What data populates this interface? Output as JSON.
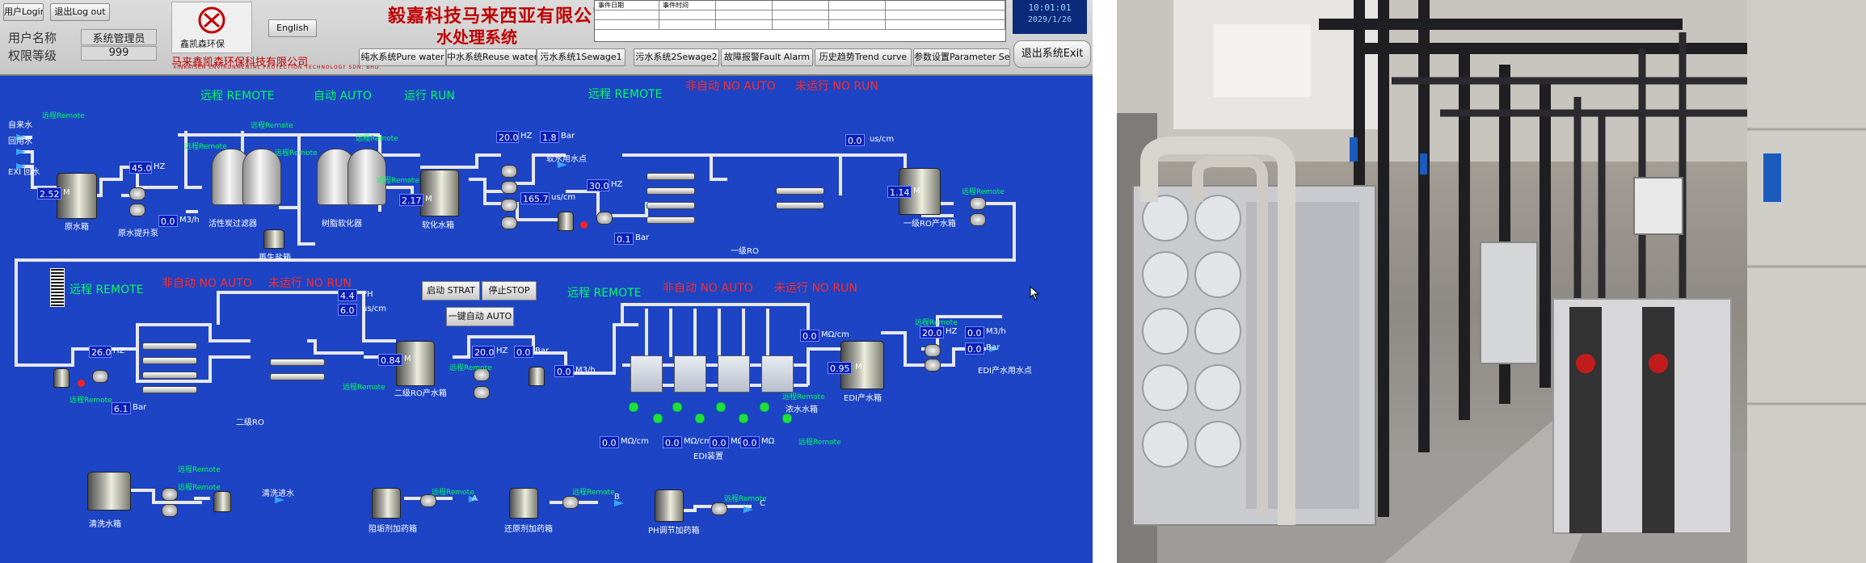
{
  "header": {
    "login_button": "用户Login",
    "logout_button": "退出Log out",
    "user_label": "用户名称",
    "user_value": "系统管理员",
    "level_label": "权限等级",
    "level_value": "999",
    "logo_text": "鑫凯森环保",
    "english_button": "English",
    "company_name": "毅嘉科技马来西亚有限公司",
    "system_title": "水处理系统",
    "sub_company": "马来鑫凯森环保科技有限公司",
    "sub_company_en": "XINKAISEN ENVIRONMENTAL PROTECTION TECHNOLOGY SDN. BHD.",
    "alarm_col1": "事件日期",
    "alarm_col2": "事件时间",
    "clock_time": "10:01:01",
    "clock_date": "2029/1/26"
  },
  "nav": [
    "纯水系统Pure water",
    "中水系统Reuse water",
    "污水系统1Sewage1",
    "污水系统2Sewage2",
    "故障报警Fault Alarm",
    "历史趋势Trend curve",
    "参数设置Parameter Set",
    "退出系统Exit"
  ],
  "status": {
    "remote": "远程 REMOTE",
    "auto": "自动 AUTO",
    "run": "运行 RUN",
    "not_auto": "非自动 NO AUTO",
    "not_run": "未运行 NO RUN",
    "remote_small": "远程Remote"
  },
  "labels": {
    "tap_water": "自来水",
    "reuse_water": "回用水",
    "exi_return": "EXI 回水",
    "raw_tank": "原水箱",
    "raw_pump": "原水提升泵",
    "carbon_filter": "活性炭过滤器",
    "resin_softener": "树脂软化器",
    "salt_box": "再生盐箱",
    "soft_tank": "软化水箱",
    "soft_point": "软水用水点",
    "ro1": "一级RO",
    "ro1_tank": "一级RO产水箱",
    "ro2": "二级RO",
    "ro2_tank": "二级RO产水箱",
    "edi": "EDI装置",
    "concentrate_tank": "浓水水箱",
    "edi_tank": "EDI产水箱",
    "edi_point": "EDI产水用水点",
    "clean_tank": "清洗水箱",
    "clean_in": "清洗进水",
    "scale_dosing": "阻垢剂加药箱",
    "reduce_dosing": "还原剂加药箱",
    "ph_dosing": "PH调节加药箱",
    "start_button": "启动 STRAT",
    "stop_button": "停止STOP",
    "auto_button": "一键自动 AUTO",
    "a": "A",
    "b": "B",
    "c": "C"
  },
  "values": {
    "raw_level": "2.52",
    "raw_pump_hz": "45.0",
    "raw_flow": "0.0",
    "soft_level": "2.17",
    "ro1_pump_hz": "20.0",
    "ro1_pressure1": "1.8",
    "ro1_flow": "165.7",
    "ro1_hp_hz": "30.0",
    "ro1_pressure2": "0.1",
    "ro1_cond": "0.0",
    "ro1_tank_level": "1.14",
    "ro2_hz": "26.0",
    "ro2_pressure": "6.1",
    "ph": "4.4",
    "ro2_cond": "6.0",
    "ro2_tank_level": "0.84",
    "edi_pump_hz": "20.0",
    "edi_pump_bar": "0.0",
    "edi_flow_in": "0.0",
    "edi_cond1": "0.0",
    "edi_tank_level": "0.95",
    "edi_cond2": "0.0",
    "edi_out_hz": "20.0",
    "edi_out_flow": "0.0",
    "edi_out_bar": "0.0",
    "edi_b1": "0.0",
    "edi_b2": "0.0",
    "edi_b3": "0.0",
    "edi_b4": "0.0"
  },
  "units": {
    "hz": "HZ",
    "bar": "Bar",
    "m": "M",
    "m3h": "M3/h",
    "uscm": "us/cm",
    "mocm": "MΩ/cm",
    "mo": "MΩ",
    "ph": "PH"
  },
  "colors": {
    "panel_bg": "#1c44c4",
    "status_green": "#00ff60",
    "status_red": "#ff2a2a",
    "status_yellow": "#ffff55",
    "company_red": "#c00000"
  }
}
